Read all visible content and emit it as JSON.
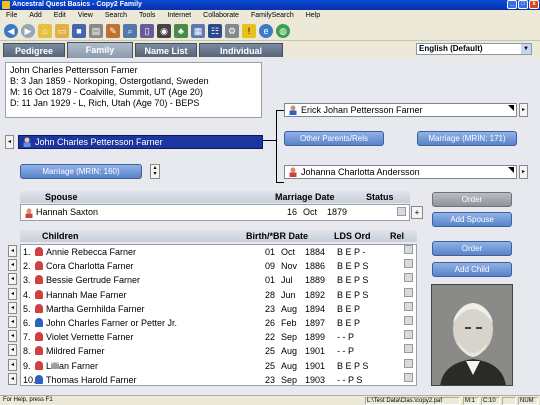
{
  "window": {
    "title": "Ancestral Quest Basics - Copy2 Family",
    "buttons": [
      "_",
      "□",
      "x"
    ]
  },
  "menu": [
    "File",
    "Add",
    "Edit",
    "View",
    "Search",
    "Tools",
    "Internet",
    "Collaborate",
    "FamilySearch",
    "Help"
  ],
  "toolbar_icons": [
    "back-arrow-icon",
    "forward-arrow-icon",
    "home-icon",
    "folder-open-icon",
    "save-icon",
    "print-icon",
    "edit-icon",
    "search-icon",
    "book-icon",
    "camera-icon",
    "tree-icon",
    "chart-icon",
    "pedigree-icon",
    "gear-icon",
    "warning-icon",
    "internet-icon",
    "globe-icon"
  ],
  "tabs": [
    "Pedigree",
    "Family",
    "Name List",
    "Individual"
  ],
  "language": "English (Default)",
  "individual": {
    "name": "John Charles Pettersson Farner",
    "birth": "B: 3 Jan 1859 - Norkoping, Ostergotland, Sweden",
    "marriage": "M: 16 Oct 1879 - Coalville, Summit, UT (Age 20)",
    "death": "D: 11 Jan 1929 - L, Rich, Utah (Age 70)      - BEPS"
  },
  "father": {
    "name": "Erick Johan Pettersson Farner"
  },
  "mother": {
    "name": "Johanna Charlotta Andersson"
  },
  "primary": {
    "name": "John Charles Pettersson Farner"
  },
  "buttons": {
    "other_parents": "Other Parents/Rels",
    "marriage_parents": "Marriage (MRIN: 171)",
    "marriage_spouse": "Marriage (MRIN: 160)",
    "order_spouse": "Order",
    "add_spouse": "Add Spouse",
    "order_child": "Order",
    "add_child": "Add Child"
  },
  "spouse_header": {
    "spouse": "Spouse",
    "marriage_date": "Marriage Date",
    "status": "Status"
  },
  "spouse": {
    "name": "Hannah Saxton",
    "day": "16",
    "month": "Oct",
    "year": "1879"
  },
  "children_header": {
    "children": "Children",
    "birth": "Birth/*BR Date",
    "lds": "LDS Ord",
    "rel": "Rel"
  },
  "children": [
    {
      "num": "1.",
      "name": "Annie Rebecca Farner",
      "day": "01",
      "month": "Oct",
      "year": "1884",
      "lds": "B E P -",
      "sex": "F"
    },
    {
      "num": "2.",
      "name": "Cora Charlotta Farner",
      "day": "09",
      "month": "Nov",
      "year": "1886",
      "lds": "B E P S",
      "sex": "F"
    },
    {
      "num": "3.",
      "name": "Bessie Gertrude Farner",
      "day": "01",
      "month": "Jul",
      "year": "1889",
      "lds": "B E P S",
      "sex": "F"
    },
    {
      "num": "4.",
      "name": "Hannah Mae Farner",
      "day": "28",
      "month": "Jun",
      "year": "1892",
      "lds": "B E P S",
      "sex": "F"
    },
    {
      "num": "5.",
      "name": "Martha Gernhilda Farner",
      "day": "23",
      "month": "Aug",
      "year": "1894",
      "lds": "B E P",
      "sex": "F"
    },
    {
      "num": "6.",
      "name": "John Charles Farner or Petter Jr.",
      "day": "26",
      "month": "Feb",
      "year": "1897",
      "lds": "B E P",
      "sex": "M"
    },
    {
      "num": "7.",
      "name": "Violet Vernette Farner",
      "day": "22",
      "month": "Sep",
      "year": "1899",
      "lds": "- - P",
      "sex": "F"
    },
    {
      "num": "8.",
      "name": "Mildred Farner",
      "day": "25",
      "month": "Aug",
      "year": "1901",
      "lds": "- - P",
      "sex": "F"
    },
    {
      "num": "9.",
      "name": "Lillian Farner",
      "day": "25",
      "month": "Aug",
      "year": "1901",
      "lds": "B E P S",
      "sex": "F"
    },
    {
      "num": "10.",
      "name": "Thomas Harold Farner",
      "day": "23",
      "month": "Sep",
      "year": "1903",
      "lds": "- - P S",
      "sex": "M"
    }
  ],
  "status": {
    "help": "For Help, press F1",
    "path": "L:\\Test Data\\Clas.\\copy2.paf",
    "m": "M:1",
    "c": "C:10",
    "num": "NUM"
  },
  "colors": {
    "selected": "#1c36a0",
    "female": "#d04040",
    "male": "#3060c0",
    "button": "#5a82c8"
  }
}
